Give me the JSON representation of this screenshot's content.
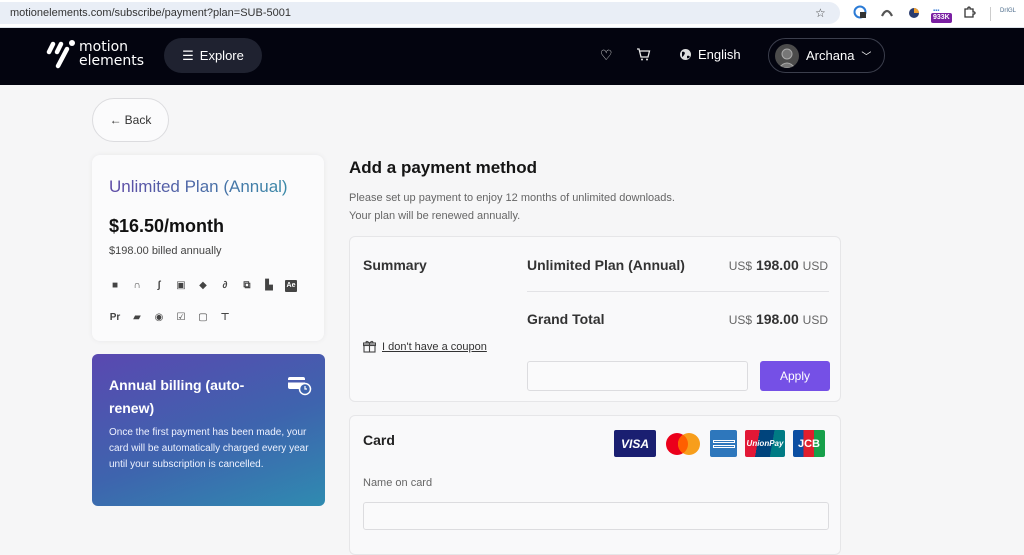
{
  "browser": {
    "url": "motionelements.com/subscribe/payment?plan=SUB-5001",
    "extension_badge": "933K",
    "profile_label": "DrIGL"
  },
  "header": {
    "logo_line1": "motion",
    "logo_line2": "elements",
    "explore_label": "Explore",
    "language_label": "English",
    "user_name": "Archana"
  },
  "back_label": "Back",
  "plan": {
    "title": "Unlimited Plan (Annual)",
    "price": "$16.50/month",
    "billed": "$198.00 billed annually",
    "asset_icons": [
      {
        "name": "video-icon",
        "glyph": "■"
      },
      {
        "name": "headphones-icon",
        "glyph": "∩"
      },
      {
        "name": "sound-wave-icon",
        "glyph": "ʃ"
      },
      {
        "name": "image-icon",
        "glyph": "▣"
      },
      {
        "name": "3d-model-icon",
        "glyph": "◆"
      },
      {
        "name": "lottie-icon",
        "glyph": "∂"
      },
      {
        "name": "transitions-icon",
        "glyph": "⧉"
      },
      {
        "name": "templates-icon",
        "glyph": "▙"
      },
      {
        "name": "after-effects-icon",
        "glyph": "Ae"
      },
      {
        "name": "premiere-pro-icon",
        "glyph": "Pr"
      },
      {
        "name": "clapperboard-icon",
        "glyph": "▰"
      },
      {
        "name": "davinci-resolve-icon",
        "glyph": "◉"
      },
      {
        "name": "edit-icon",
        "glyph": "☑"
      },
      {
        "name": "final-cut-icon",
        "glyph": "▢"
      },
      {
        "name": "presentation-icon",
        "glyph": "⊤"
      }
    ]
  },
  "annual": {
    "title": "Annual billing (auto-renew)",
    "text": "Once the first payment has been made, your card will be automatically charged every year until your subscription is cancelled."
  },
  "main": {
    "title": "Add a payment method",
    "desc_line1": "Please set up payment to enjoy 12 months of unlimited downloads.",
    "desc_line2": "Your plan will be renewed annually."
  },
  "summary": {
    "label": "Summary",
    "item_name": "Unlimited Plan (Annual)",
    "item_prefix": "US$",
    "item_amount": "198.00",
    "item_currency": "USD",
    "total_label": "Grand Total",
    "total_prefix": "US$",
    "total_amount": "198.00",
    "total_currency": "USD",
    "coupon_link": "I don't have a coupon",
    "coupon_value": "",
    "coupon_placeholder": "",
    "apply_label": "Apply"
  },
  "card": {
    "label": "Card",
    "brands": [
      "VISA",
      "Mastercard",
      "American Express",
      "UnionPay",
      "JCB"
    ],
    "name_label": "Name on card",
    "name_value": "",
    "name_placeholder": ""
  },
  "colors": {
    "accent": "#7550e6",
    "header_bg": "#03040f"
  }
}
